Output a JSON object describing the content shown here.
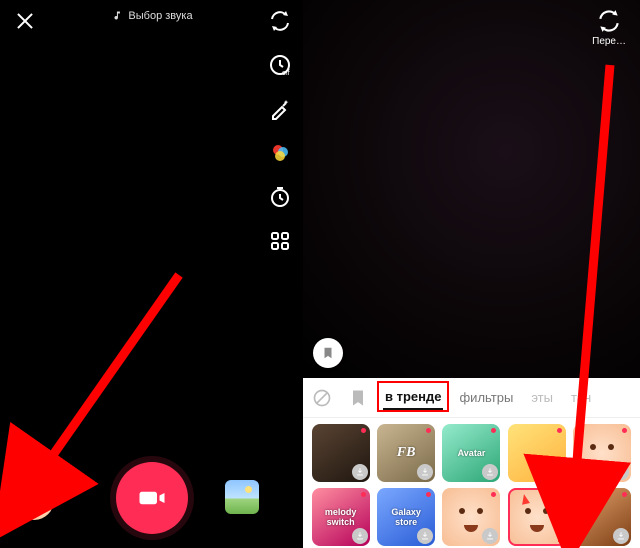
{
  "left": {
    "sound_label": "Выбор звука"
  },
  "right": {
    "switch_label": "Пере…"
  },
  "drawer": {
    "tabs": {
      "trending": "в тренде",
      "filters": "фильтры",
      "effects_partial": "эты",
      "dance_partial": "тан"
    },
    "tiles": [
      {
        "name": "effect-1",
        "label": ""
      },
      {
        "name": "effect-2",
        "label": "FB"
      },
      {
        "name": "effect-3",
        "label": "Avatar"
      },
      {
        "name": "effect-4",
        "label": ""
      },
      {
        "name": "effect-5",
        "label": ""
      },
      {
        "name": "effect-6",
        "label": "melody switch"
      },
      {
        "name": "effect-7",
        "label": "Galaxy store"
      },
      {
        "name": "effect-8",
        "label": ""
      },
      {
        "name": "effect-9-devil",
        "label": ""
      },
      {
        "name": "effect-10",
        "label": ""
      }
    ]
  }
}
